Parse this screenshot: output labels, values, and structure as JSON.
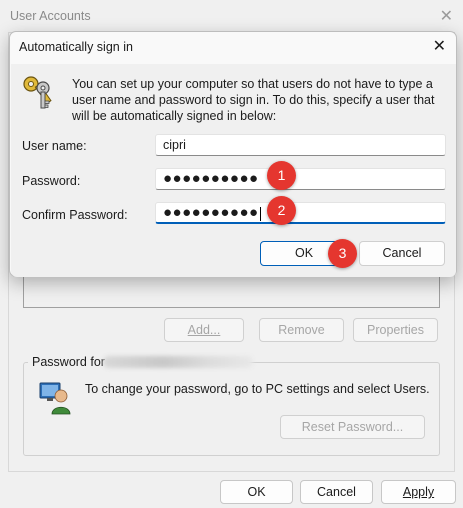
{
  "background_window": {
    "title": "User Accounts",
    "buttons": {
      "add": "Add...",
      "remove": "Remove",
      "properties": "Properties"
    },
    "password_group": {
      "label": "Password for",
      "text": "To change your password, go to PC settings and select Users.",
      "reset_button": "Reset Password..."
    },
    "footer": {
      "ok": "OK",
      "cancel": "Cancel",
      "apply": "Apply"
    }
  },
  "dialog": {
    "title": "Automatically sign in",
    "description": "You can set up your computer so that users do not have to type a user name and password to sign in. To do this, specify a user that will be automatically signed in below:",
    "fields": {
      "username_label": "User name:",
      "username_value": "cipri",
      "password_label": "Password:",
      "password_value": "●●●●●●●●●●",
      "confirm_label": "Confirm Password:",
      "confirm_value": "●●●●●●●●●●"
    },
    "buttons": {
      "ok": "OK",
      "cancel": "Cancel"
    }
  },
  "annotations": [
    "1",
    "2",
    "3"
  ],
  "icons": {
    "close": "close-icon",
    "keys": "keys-icon",
    "user": "user-with-monitor-icon"
  },
  "colors": {
    "accent": "#005fb8",
    "marker": "#e5362f"
  }
}
